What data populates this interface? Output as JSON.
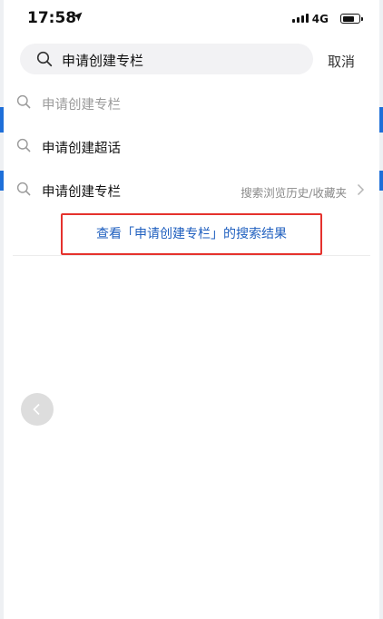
{
  "status_bar": {
    "time": "17:58",
    "network": "4G"
  },
  "search": {
    "query": "申请创建专栏",
    "cancel_label": "取消"
  },
  "suggestions": [
    {
      "label": "申请创建专栏"
    },
    {
      "label": "申请创建超话"
    },
    {
      "label": "申请创建专栏",
      "hint": "搜索浏览历史/收藏夹"
    }
  ],
  "view_results": {
    "label": "查看「申请创建专栏」的搜索结果"
  },
  "colors": {
    "highlight_border": "#e5322d",
    "link": "#1f5fbf",
    "search_bg": "#f2f2f4"
  }
}
